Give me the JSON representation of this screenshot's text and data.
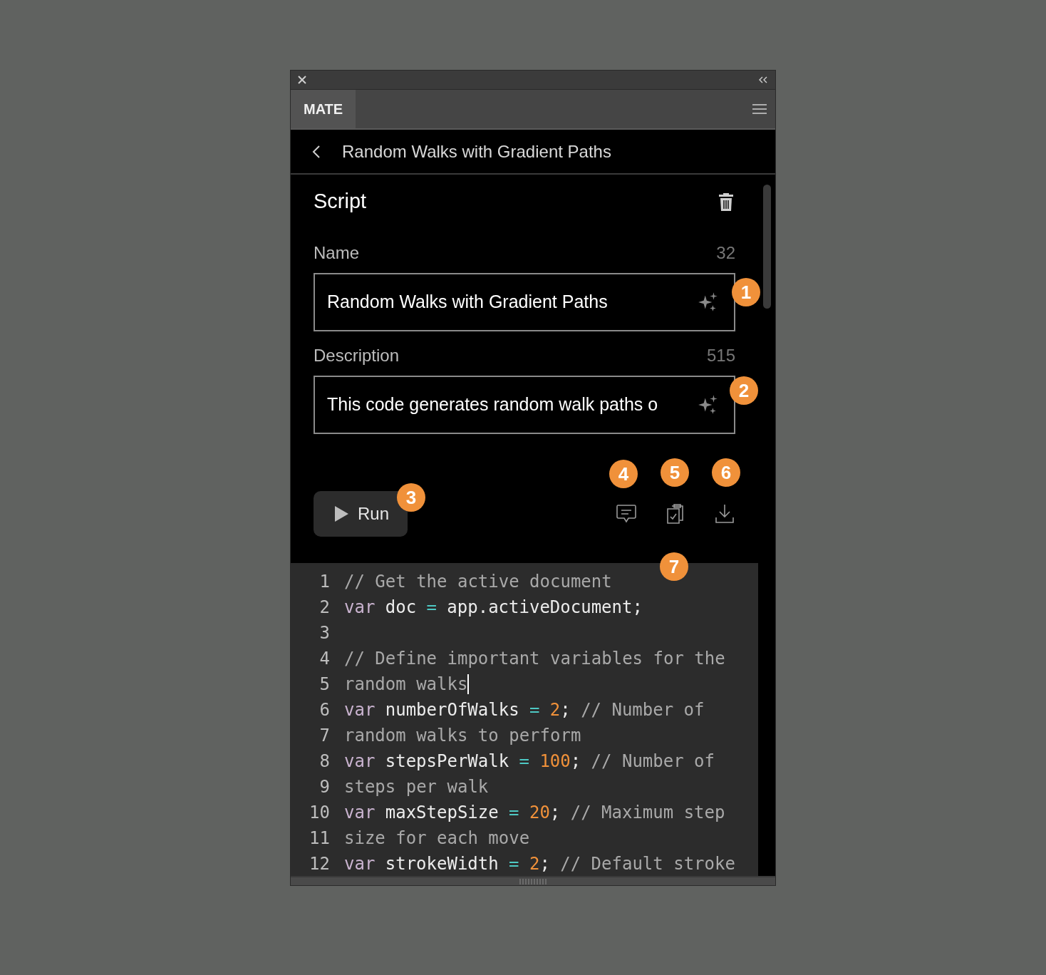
{
  "panel": {
    "tab": "MATE"
  },
  "header": {
    "title": "Random Walks with Gradient Paths"
  },
  "section": {
    "title": "Script"
  },
  "fields": [
    {
      "label": "Name",
      "count": "32",
      "value": "Random Walks with Gradient Paths"
    },
    {
      "label": "Description",
      "count": "515",
      "value": "This code generates random walk paths o"
    }
  ],
  "run_button": {
    "label": "Run"
  },
  "callouts": [
    "1",
    "2",
    "3",
    "4",
    "5",
    "6",
    "7"
  ],
  "code": [
    {
      "number": "1",
      "tokens": [
        {
          "kind": "comment",
          "text": "// Get the active document"
        }
      ]
    },
    {
      "number": "2",
      "tokens": [
        {
          "kind": "keyword",
          "text": "var"
        },
        {
          "kind": "ident",
          "text": "doc"
        },
        {
          "kind": "op",
          "text": "="
        },
        {
          "kind": "ident",
          "text": "app.activeDocument;"
        }
      ]
    },
    {
      "number": "3"
    },
    {
      "number": "4",
      "tokens": [
        {
          "kind": "comment",
          "text": "// Define important variables for the"
        }
      ]
    },
    {
      "number": "5",
      "cursor": true,
      "tokens": [
        {
          "kind": "comment",
          "text": "random walks"
        }
      ]
    },
    {
      "number": "6",
      "tokens": [
        {
          "kind": "keyword",
          "text": "var"
        },
        {
          "kind": "ident",
          "text": "numberOfWalks"
        },
        {
          "kind": "op",
          "text": "="
        },
        {
          "kind": "number",
          "text": "2"
        },
        {
          "kind": "punct",
          "text": ";"
        },
        {
          "kind": "comment",
          "text": "// Number of"
        }
      ]
    },
    {
      "number": "7",
      "tokens": [
        {
          "kind": "comment",
          "text": "random walks to perform"
        }
      ]
    },
    {
      "number": "8",
      "tokens": [
        {
          "kind": "keyword",
          "text": "var"
        },
        {
          "kind": "ident",
          "text": "stepsPerWalk"
        },
        {
          "kind": "op",
          "text": "="
        },
        {
          "kind": "number",
          "text": "100"
        },
        {
          "kind": "punct",
          "text": ";"
        },
        {
          "kind": "comment",
          "text": "// Number of"
        }
      ]
    },
    {
      "number": "9",
      "tokens": [
        {
          "kind": "comment",
          "text": "steps per walk"
        }
      ]
    },
    {
      "number": "10",
      "tokens": [
        {
          "kind": "keyword",
          "text": "var"
        },
        {
          "kind": "ident",
          "text": "maxStepSize"
        },
        {
          "kind": "op",
          "text": "="
        },
        {
          "kind": "number",
          "text": "20"
        },
        {
          "kind": "punct",
          "text": ";"
        },
        {
          "kind": "comment",
          "text": "// Maximum step"
        }
      ]
    },
    {
      "number": "11",
      "tokens": [
        {
          "kind": "comment",
          "text": "size for each move"
        }
      ]
    },
    {
      "number": "12",
      "tokens": [
        {
          "kind": "keyword",
          "text": "var"
        },
        {
          "kind": "ident",
          "text": "strokeWidth"
        },
        {
          "kind": "op",
          "text": "="
        },
        {
          "kind": "number",
          "text": "2"
        },
        {
          "kind": "punct",
          "text": ";"
        },
        {
          "kind": "comment",
          "text": "// Default stroke"
        }
      ]
    }
  ]
}
